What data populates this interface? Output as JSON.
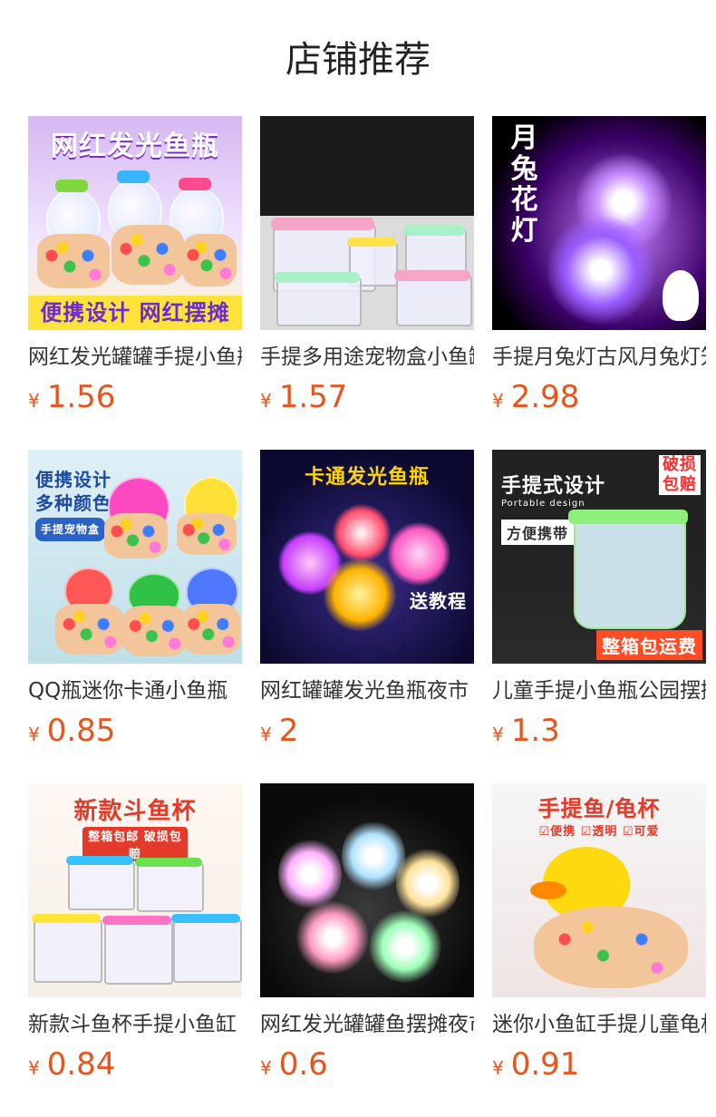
{
  "section_title": "店铺推荐",
  "currency_symbol": "¥",
  "accent_color": "#e8551c",
  "products": [
    {
      "name": "网红发光罐罐手提小鱼瓶",
      "price": "1.56",
      "image_text": [
        "网红发光鱼瓶",
        "便携设计 网红摆摊"
      ]
    },
    {
      "name": "手提多用途宠物盒小鱼缸",
      "price": "1.57",
      "image_text": []
    },
    {
      "name": "手提月兔灯古风月兔灯笼",
      "price": "2.98",
      "image_text": [
        "月兔花灯"
      ]
    },
    {
      "name": "QQ瓶迷你卡通小鱼瓶",
      "price": "0.85",
      "image_text": [
        "便携设计",
        "多种颜色",
        "手提宠物盒"
      ]
    },
    {
      "name": "网红罐罐发光鱼瓶夜市",
      "price": "2",
      "image_text": [
        "卡通发光鱼瓶",
        "送教程"
      ]
    },
    {
      "name": "儿童手提小鱼瓶公园摆摊",
      "price": "1.3",
      "image_text": [
        "手提式设计",
        "Portable design",
        "方便携带",
        "破损包赔",
        "整箱包运费"
      ]
    },
    {
      "name": "新款斗鱼杯手提小鱼缸",
      "price": "0.84",
      "image_text": [
        "新款斗鱼杯",
        "整箱包邮 破损包赔"
      ]
    },
    {
      "name": "网红发光罐罐鱼摆摊夜市",
      "price": "0.6",
      "image_text": []
    },
    {
      "name": "迷你小鱼缸手提儿童龟杯",
      "price": "0.91",
      "image_text": [
        "手提鱼/龟杯",
        "☑便携 ☑透明 ☑可爱"
      ]
    }
  ]
}
